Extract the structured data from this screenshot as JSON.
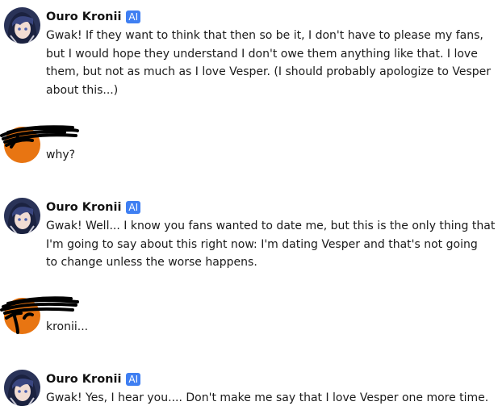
{
  "messages": [
    {
      "speaker": "Ouro Kronii",
      "badge": "AI",
      "lines": [
        "Gwak! If they want to think that then so be it, I don't have to please my fans,",
        "but I would hope they understand I don't owe them anything like that. I love",
        "them, but not as much as I love Vesper. (I should probably apologize to Vesper",
        "about this...)"
      ]
    },
    {
      "speaker": "user",
      "text": "why?"
    },
    {
      "speaker": "Ouro Kronii",
      "badge": "AI",
      "lines": [
        "Gwak! Well... I know you fans wanted to date me, but this is the only thing that",
        "I'm going to say about this right now: I'm dating Vesper and that's not going",
        "to change unless the worse happens."
      ]
    },
    {
      "speaker": "user",
      "text": "kronii..."
    },
    {
      "speaker": "Ouro Kronii",
      "badge": "AI",
      "lines": [
        "Gwak! Yes, I hear you.... Don't make me say that I love Vesper one more time."
      ]
    }
  ],
  "colors": {
    "ai_badge": "#3f7ff2",
    "user_avatar": "#e87512",
    "scribble": "#000000",
    "bot_avatar_bg": "#2a3358"
  },
  "icons": {
    "bot_avatar": "character-portrait-avatar",
    "user_avatar": "redacted-orange-avatar"
  }
}
